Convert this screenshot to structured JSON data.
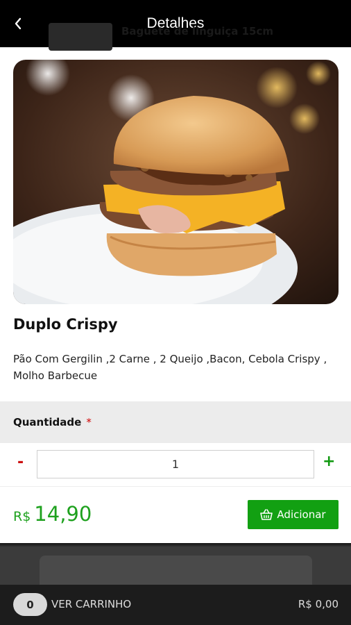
{
  "header": {
    "title": "Detalhes",
    "back_icon": "chevron-left-icon"
  },
  "product": {
    "image_alt": "burger-photo",
    "name": "Duplo Crispy",
    "description": "Pão Com Gergilin ,2 Carne , 2 Queijo ,Bacon, Cebola Crispy , Molho Barbecue"
  },
  "quantity": {
    "label": "Quantidade",
    "required_mark": "*",
    "minus": "-",
    "plus": "+",
    "value": "1"
  },
  "price": {
    "currency": "R$",
    "value": "14,90"
  },
  "add_button": {
    "label": "Adicionar",
    "icon": "basket-icon"
  },
  "background_list": {
    "item_name": "Baguete de linguiça 15cm"
  },
  "cart_bar": {
    "count": "0",
    "label": "VER CARRINHO",
    "total": "R$ 0,00"
  },
  "colors": {
    "accent_green": "#12a012",
    "required_red": "#d00000",
    "topbar": "#000000"
  }
}
